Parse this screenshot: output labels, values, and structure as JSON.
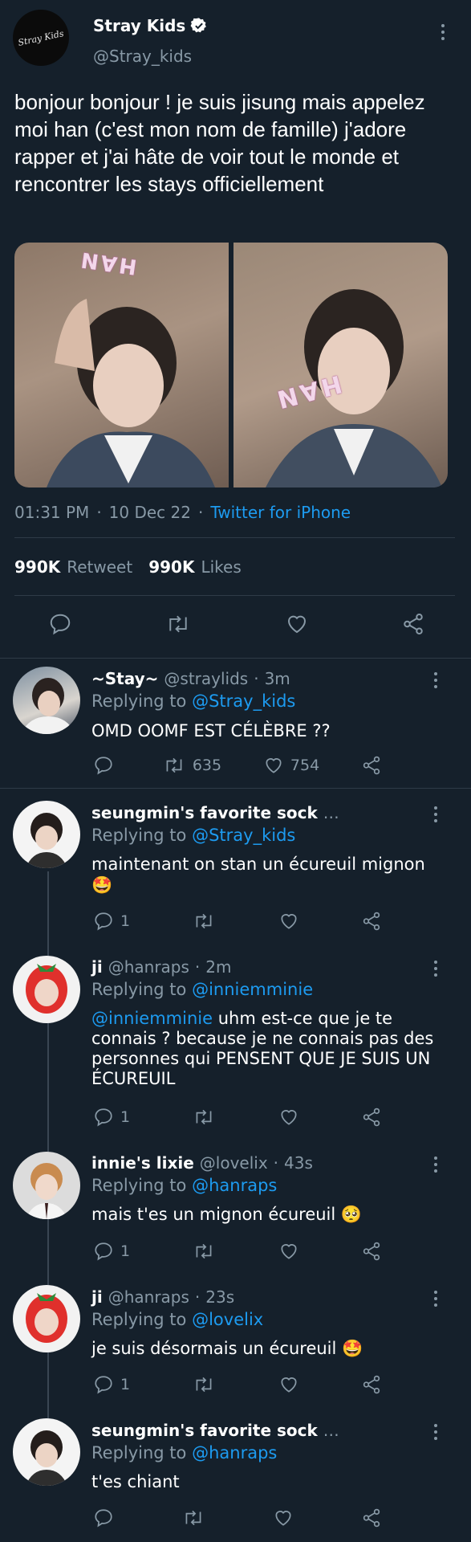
{
  "main_tweet": {
    "display_name": "Stray Kids",
    "handle": "@Stray_kids",
    "logo_text": "Stray Kids",
    "text": "bonjour bonjour ! je suis jisung mais appelez moi han (c'est mon nom de famille) j'adore rapper et j'ai hâte de voir tout le monde et rencontrer les stays officiellement",
    "photo_sign_text": "HAN",
    "time": "01:31 PM",
    "sep": "·",
    "date": "10 Dec 22",
    "source": "Twitter for iPhone",
    "retweet_count": "990K",
    "retweet_label": "Retweet",
    "likes_count": "990K",
    "likes_label": "Likes"
  },
  "replies": [
    {
      "name": "~Stay~",
      "handle": "@straylids",
      "sep": "·",
      "time": "3m",
      "replying_label": "Replying to",
      "replying_to": "@Stray_kids",
      "text": "OMD OOMF EST CÉLÈBRE ??",
      "text_mention": "",
      "emoji": "",
      "reply_count": "",
      "retweet_count": "635",
      "like_count": "754"
    },
    {
      "name": "seungmin's favorite sock",
      "handle": "…",
      "sep": "",
      "time": "",
      "replying_label": "Replying to",
      "replying_to": "@Stray_kids",
      "text": "maintenant on stan un écureuil mignon",
      "text_mention": "",
      "emoji": "🤩",
      "reply_count": "1",
      "retweet_count": "",
      "like_count": ""
    },
    {
      "name": "ji",
      "handle": "@hanraps",
      "sep": "·",
      "time": "2m",
      "replying_label": "Replying to",
      "replying_to": "@inniemminie",
      "text": " uhm est-ce que je te connais ? because je ne connais pas des personnes qui PENSENT QUE JE SUIS UN ÉCUREUIL",
      "text_mention": "@inniemminie",
      "emoji": "",
      "reply_count": "1",
      "retweet_count": "",
      "like_count": ""
    },
    {
      "name": "innie's lixie",
      "handle": "@lovelix",
      "sep": "·",
      "time": "43s",
      "replying_label": "Replying to",
      "replying_to": "@hanraps",
      "text": "mais t'es un mignon écureuil",
      "text_mention": "",
      "emoji": "🥺",
      "reply_count": "1",
      "retweet_count": "",
      "like_count": ""
    },
    {
      "name": "ji",
      "handle": "@hanraps",
      "sep": "·",
      "time": "23s",
      "replying_label": "Replying to",
      "replying_to": "@lovelix",
      "text": "je suis désormais un écureuil",
      "text_mention": "",
      "emoji": "🤩",
      "reply_count": "1",
      "retweet_count": "",
      "like_count": ""
    },
    {
      "name": "seungmin's favorite sock",
      "handle": "…",
      "sep": "",
      "time": "",
      "replying_label": "Replying to",
      "replying_to": "@hanraps",
      "text": "t'es chiant",
      "text_mention": "",
      "emoji": "",
      "reply_count": "",
      "retweet_count": "",
      "like_count": ""
    }
  ],
  "icons": [
    "verified-badge-icon",
    "more-icon",
    "reply-icon",
    "retweet-icon",
    "like-icon",
    "share-icon"
  ],
  "colors": {
    "background": "#15202b",
    "text": "#ffffff",
    "muted": "#8899a6",
    "link": "#1d9bf0",
    "divider": "#2f3b47"
  }
}
